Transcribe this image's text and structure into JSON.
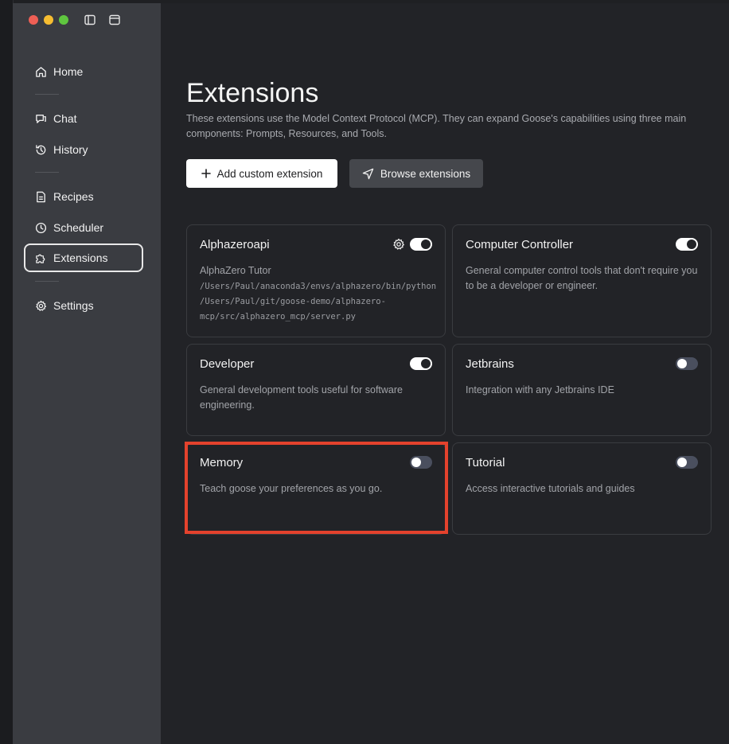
{
  "sidebar": {
    "items": [
      {
        "label": "Home",
        "icon": "home-icon"
      },
      {
        "label": "Chat",
        "icon": "chat-icon"
      },
      {
        "label": "History",
        "icon": "history-icon"
      },
      {
        "label": "Recipes",
        "icon": "recipe-icon"
      },
      {
        "label": "Scheduler",
        "icon": "clock-icon"
      },
      {
        "label": "Extensions",
        "icon": "puzzle-icon",
        "active": true
      },
      {
        "label": "Settings",
        "icon": "gear-icon"
      }
    ]
  },
  "main": {
    "title": "Extensions",
    "subtitle": "These extensions use the Model Context Protocol (MCP). They can expand Goose's capabilities using three main components: Prompts, Resources, and Tools.",
    "add_button_label": "Add custom extension",
    "browse_button_label": "Browse extensions"
  },
  "extensions": [
    {
      "name": "Alphazeroapi",
      "description": "AlphaZero Tutor",
      "path": "/Users/Paul/anaconda3/envs/alphazero/bin/python\n/Users/Paul/git/goose-demo/alphazero-\nmcp/src/alphazero_mcp/server.py",
      "enabled": true,
      "has_settings": true
    },
    {
      "name": "Computer Controller",
      "description": "General computer control tools that don't require you to be a developer or engineer.",
      "enabled": true
    },
    {
      "name": "Developer",
      "description": "General development tools useful for software engineering.",
      "enabled": true
    },
    {
      "name": "Jetbrains",
      "description": "Integration with any Jetbrains IDE",
      "enabled": false
    },
    {
      "name": "Memory",
      "description": "Teach goose your preferences as you go.",
      "enabled": false,
      "highlighted": true
    },
    {
      "name": "Tutorial",
      "description": "Access interactive tutorials and guides",
      "enabled": false
    }
  ],
  "colors": {
    "accent_highlight": "#e4422d",
    "toggle_off": "#4a4f5e",
    "sidebar_bg": "#3a3c41"
  }
}
